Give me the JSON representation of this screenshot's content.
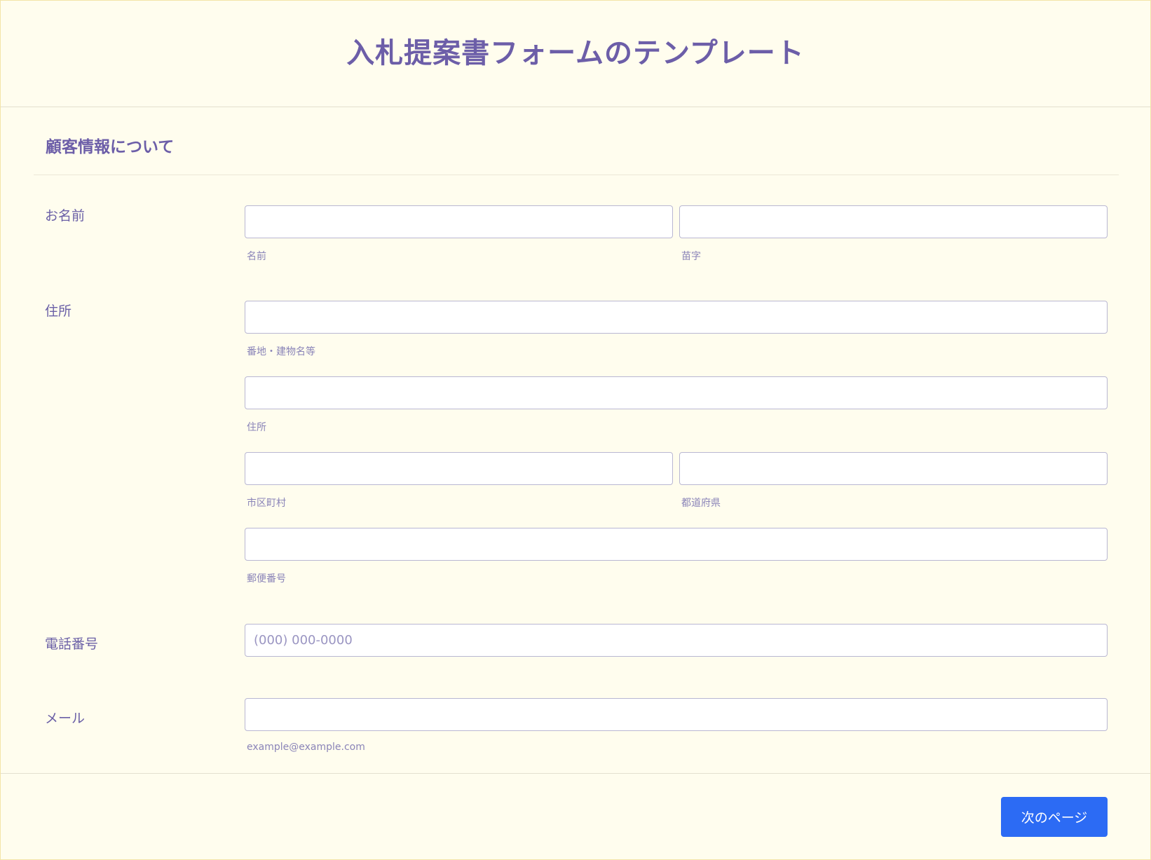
{
  "form": {
    "title": "入札提案書フォームのテンプレート"
  },
  "section": {
    "title": "顧客情報について"
  },
  "name": {
    "label": "お名前",
    "first_sublabel": "名前",
    "last_sublabel": "苗字"
  },
  "address": {
    "label": "住所",
    "street_sublabel": "番地・建物名等",
    "line2_sublabel": "住所",
    "city_sublabel": "市区町村",
    "prefecture_sublabel": "都道府県",
    "postal_sublabel": "郵便番号"
  },
  "phone": {
    "label": "電話番号",
    "placeholder": "(000) 000-0000"
  },
  "email": {
    "label": "メール",
    "sublabel": "example@example.com"
  },
  "footer": {
    "next_label": "次のページ"
  },
  "colors": {
    "background": "#fffdee",
    "text": "#6a5fa6",
    "button": "#2c6bf4"
  }
}
